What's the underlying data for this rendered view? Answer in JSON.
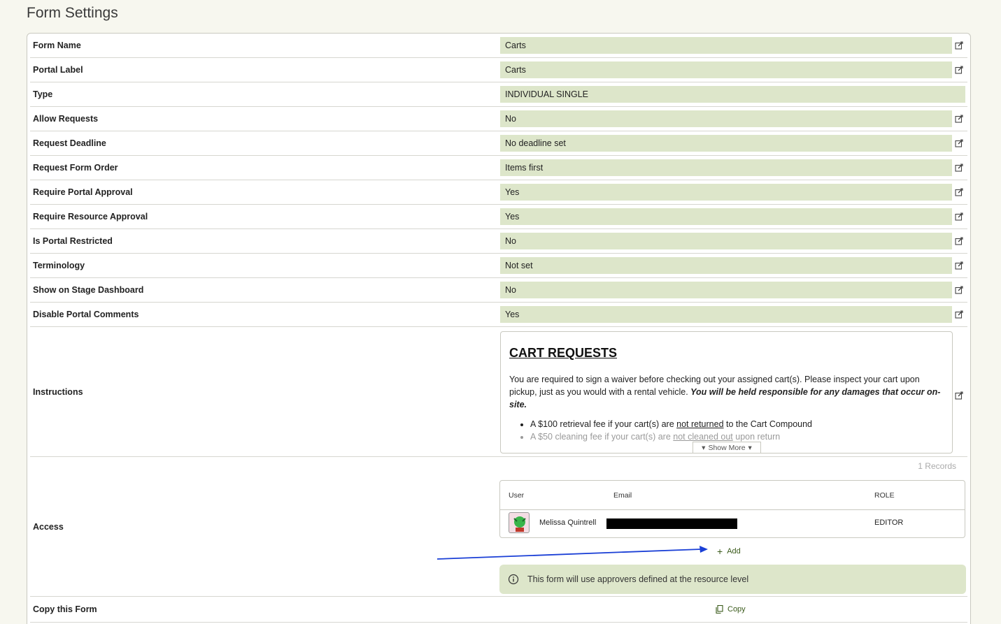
{
  "page": {
    "title": "Form Settings"
  },
  "settings": [
    {
      "label": "Form Name",
      "value": "Carts",
      "editable": true
    },
    {
      "label": "Portal Label",
      "value": "Carts",
      "editable": true
    },
    {
      "label": "Type",
      "value": "INDIVIDUAL SINGLE",
      "editable": false
    },
    {
      "label": "Allow Requests",
      "value": "No",
      "editable": true
    },
    {
      "label": "Request Deadline",
      "value": "No deadline set",
      "editable": true
    },
    {
      "label": "Request Form Order",
      "value": "Items first",
      "editable": true
    },
    {
      "label": "Require Portal Approval",
      "value": "Yes",
      "editable": true
    },
    {
      "label": "Require Resource Approval",
      "value": "Yes",
      "editable": true
    },
    {
      "label": "Is Portal Restricted",
      "value": "No",
      "editable": true
    },
    {
      "label": "Terminology",
      "value": "Not set",
      "editable": true
    },
    {
      "label": "Show on Stage Dashboard",
      "value": "No",
      "editable": true
    },
    {
      "label": "Disable Portal Comments",
      "value": "Yes",
      "editable": true
    }
  ],
  "instructions": {
    "label": "Instructions",
    "title": "CART REQUESTS",
    "para_start": "You are required to sign a waiver before checking out your assigned cart(s). Please inspect your cart upon pickup, just as you would with a rental vehicle. ",
    "para_emphasis": "You will be held responsible for any damages that occur on-site.",
    "bullet1_pre": "A $100 retrieval fee if your cart(s) are ",
    "bullet1_u": "not returned",
    "bullet1_post": " to the Cart Compound",
    "bullet2_pre": "A $50 cleaning fee if your cart(s) are ",
    "bullet2_u": "not cleaned out",
    "bullet2_post": " upon return",
    "show_more": "Show More"
  },
  "access": {
    "label": "Access",
    "records": "1 Records",
    "columns": {
      "user": "User",
      "email": "Email",
      "role": "ROLE"
    },
    "rows": [
      {
        "user": "Melissa Quintrell",
        "email": "",
        "role": "EDITOR"
      }
    ],
    "add_label": "Add",
    "info": "This form will use approvers defined at the resource level"
  },
  "copy": {
    "label": "Copy this Form",
    "button": "Copy"
  },
  "colors": {
    "value_bg": "#dde6ca",
    "accent": "#3a5a1a",
    "arrow": "#1a3fd6"
  },
  "icons": [
    "edit-icon",
    "chevron-down-icon",
    "plus-icon",
    "info-icon",
    "copy-icon",
    "avatar"
  ]
}
